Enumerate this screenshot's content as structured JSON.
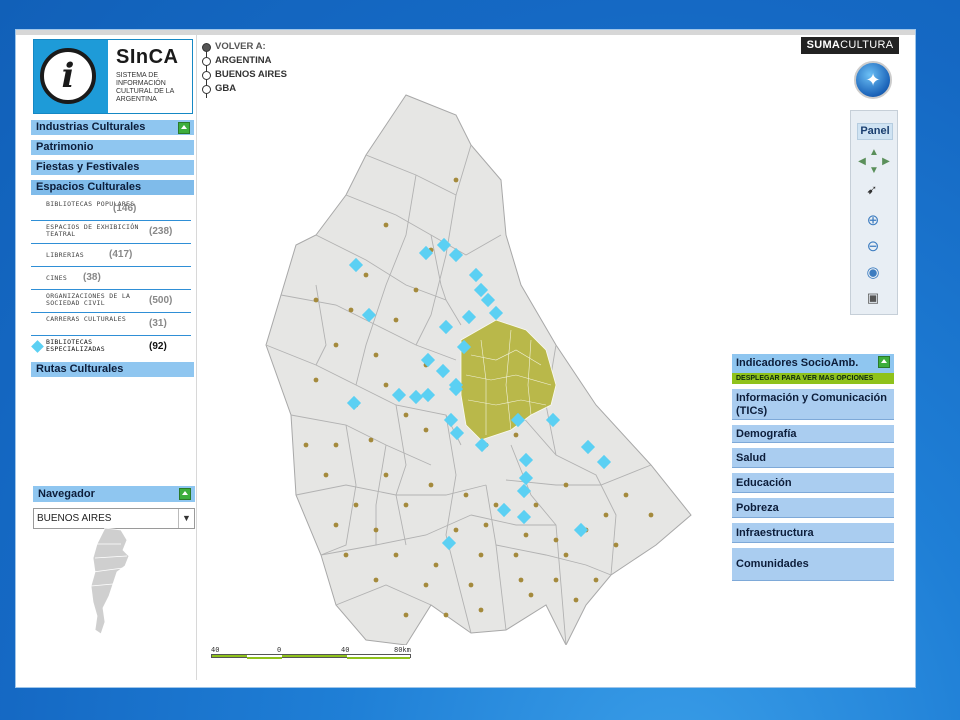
{
  "logo": {
    "title": "SInCA",
    "subtitle": "SISTEMA DE INFORMACIÓN CULTURAL DE LA ARGENTINA"
  },
  "menu": {
    "industrias": "Industrias Culturales",
    "patrimonio": "Patrimonio",
    "fiestas": "Fiestas y Festivales",
    "espacios": "Espacios Culturales",
    "subitems": [
      {
        "label": "BIBLIOTECAS POPULARES",
        "count": "(146)"
      },
      {
        "label": "ESPACIOS DE EXHIBICIÓN TEATRAL",
        "count": "(238)"
      },
      {
        "label": "LIBRERIAS",
        "count": "(417)"
      },
      {
        "label": "CINES",
        "count": "(38)"
      },
      {
        "label": "ORGANIZACIONES DE LA SOCIEDAD CIVIL",
        "count": "(500)"
      },
      {
        "label": "CARRERAS CULTURALES",
        "count": "(31)"
      },
      {
        "label": "BIBLIOTECAS ESPECIALIZADAS",
        "count": "(92)"
      }
    ],
    "rutas": "Rutas Culturales"
  },
  "navegador": {
    "title": "Navegador",
    "select_value": "BUENOS AIRES"
  },
  "breadcrumb": {
    "head": "VOLVER A:",
    "items": [
      "ARGENTINA",
      "BUENOS AIRES",
      "GBA"
    ]
  },
  "brand": {
    "bold": "SUMA",
    "light": "CULTURA"
  },
  "panel": {
    "title": "Panel"
  },
  "indicators": {
    "title": "Indicadores SocioAmb.",
    "bar": "DESPLEGAR PARA VER MAS OPCIONES",
    "items": [
      "Información y Comunicación (TICs)",
      "Demografía",
      "Salud",
      "Educación",
      "Pobreza",
      "Infraestructura",
      "Comunidades"
    ]
  },
  "scale": {
    "labels": [
      "40",
      "0",
      "40",
      "80km"
    ]
  },
  "colors": {
    "accent": "#8fc6f0",
    "marker_diamond": "#5bd0f3",
    "marker_dot": "#a48a3c",
    "capital_fill": "#b9b84a",
    "region_fill": "#e6e6e4",
    "green_bar": "#8fc21c"
  }
}
